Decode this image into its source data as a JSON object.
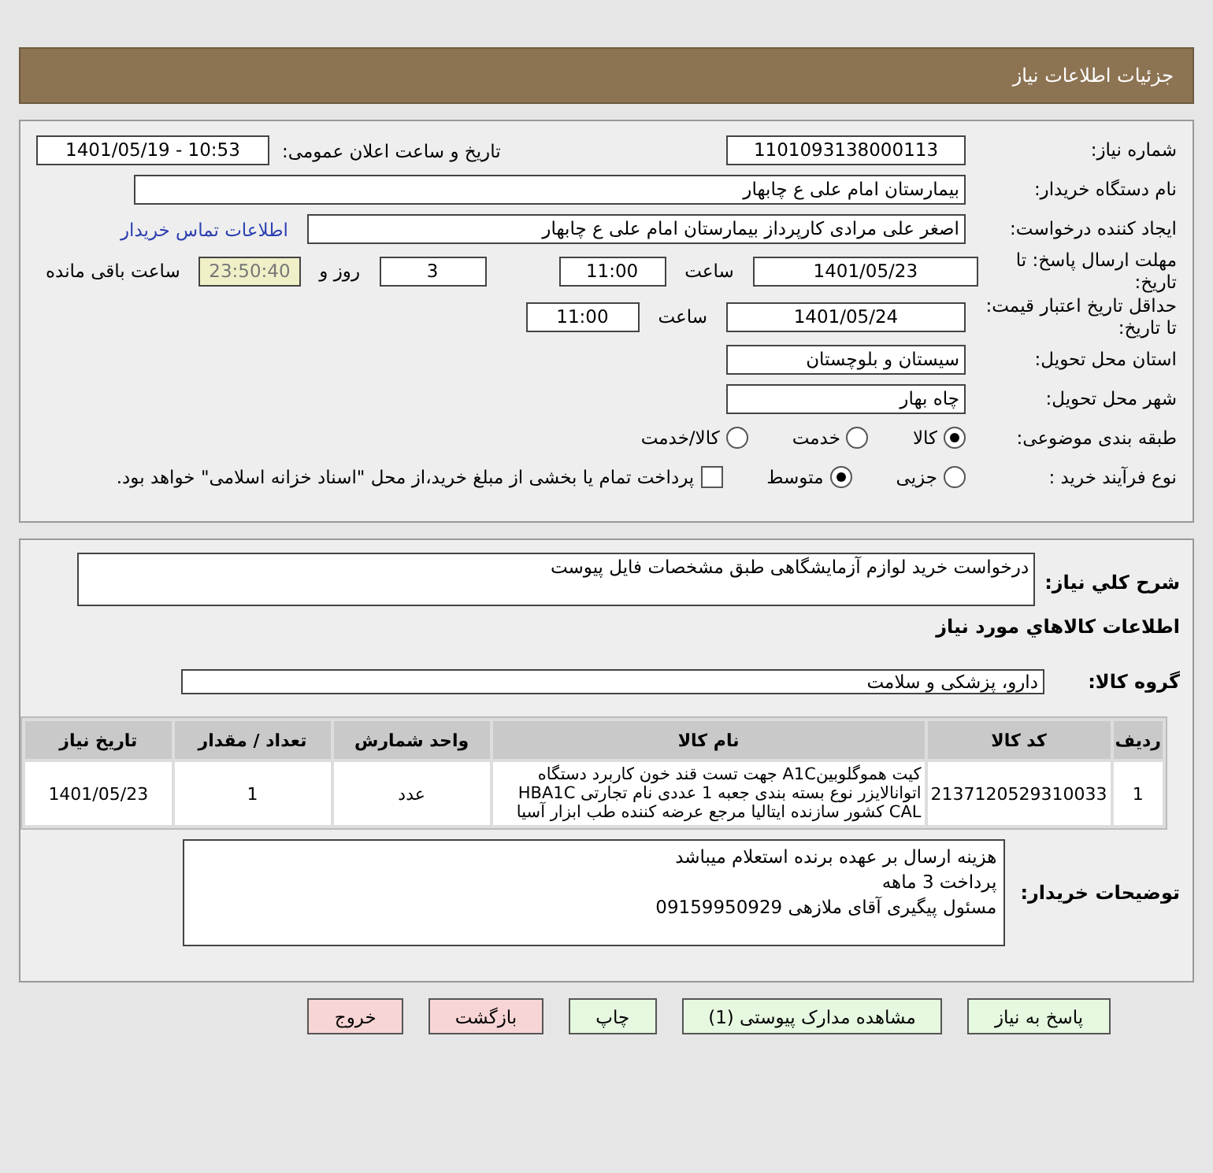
{
  "header": {
    "title": "جزئیات اطلاعات نیاز"
  },
  "need": {
    "number_label": "شماره نیاز:",
    "number": "1101093138000113",
    "announce_label": "تاریخ و ساعت اعلان عمومی:",
    "announce": "1401/05/19 - 10:53"
  },
  "buyer": {
    "label": "نام دستگاه خریدار:",
    "value": "بیمارستان امام علی  ع  چابهار"
  },
  "requester": {
    "label": "ایجاد کننده درخواست:",
    "value": "اصغر علی مرادی کارپرداز بیمارستان امام علی  ع  چابهار",
    "contact_link": "اطلاعات تماس خریدار"
  },
  "deadline": {
    "label": "مهلت ارسال پاسخ: تا تاریخ:",
    "date": "1401/05/23",
    "time_label": "ساعت",
    "time": "11:00",
    "days": "3",
    "days_label": "روز و",
    "remaining": "23:50:40",
    "remaining_label": "ساعت باقی مانده"
  },
  "validity": {
    "label": "حداقل تاریخ اعتبار قیمت: تا تاریخ:",
    "date": "1401/05/24",
    "time_label": "ساعت",
    "time": "11:00"
  },
  "province": {
    "label": "استان محل تحویل:",
    "value": "سیستان و بلوچستان"
  },
  "city": {
    "label": "شهر محل تحویل:",
    "value": "چاه بهار"
  },
  "category": {
    "label": "طبقه بندی موضوعی:",
    "options": [
      {
        "label": "کالا",
        "selected": true
      },
      {
        "label": "خدمت",
        "selected": false
      },
      {
        "label": "کالا/خدمت",
        "selected": false
      }
    ]
  },
  "process": {
    "label": "نوع فرآیند خرید :",
    "options": [
      {
        "label": "جزیی",
        "selected": false
      },
      {
        "label": "متوسط",
        "selected": true
      }
    ],
    "treasury": {
      "checked": false,
      "text": "پرداخت تمام یا بخشی از مبلغ خرید،از محل \"اسناد خزانه اسلامی\" خواهد بود."
    }
  },
  "description": {
    "label": "شرح کلي نياز:",
    "value": "درخواست خرید لوازم آزمایشگاهی طبق مشخصات فایل پیوست"
  },
  "goods_title": "اطلاعات کالاهاي مورد نياز",
  "group": {
    "label": "گروه کالا:",
    "value": "دارو، پزشکی و سلامت"
  },
  "table": {
    "columns": [
      "ردیف",
      "کد کالا",
      "نام کالا",
      "واحد شمارش",
      "تعداد / مقدار",
      "تاریخ نیاز"
    ],
    "rows": [
      [
        "1",
        "2137120529310033",
        "کیت هموگلوبینA1C جهت تست قند خون کاربرد دستگاه اتوانالایزر نوع بسته بندی جعبه 1 عددی نام تجارتی HBA1C CAL کشور سازنده ایتالیا مرجع عرضه کننده طب ابزار آسیا",
        "عدد",
        "1",
        "1401/05/23"
      ]
    ]
  },
  "notes": {
    "label": "توضیحات خریدار:",
    "lines": [
      "هزینه ارسال بر عهده برنده استعلام میباشد",
      "پرداخت 3 ماهه",
      "مسئول پیگیری آقای ملازهی 09159950929"
    ]
  },
  "buttons": [
    {
      "label": "پاسخ به نیاز",
      "kind": "action"
    },
    {
      "label": "مشاهده مدارک پیوستی (1)",
      "kind": "action"
    },
    {
      "label": "چاپ",
      "kind": "action"
    },
    {
      "label": "بازگشت",
      "kind": "exit"
    },
    {
      "label": "خروج",
      "kind": "exit"
    }
  ]
}
